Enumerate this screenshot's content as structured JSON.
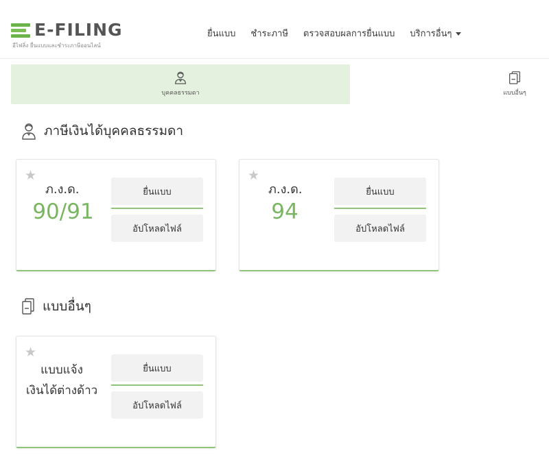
{
  "header": {
    "logo_text": "E-FILING",
    "logo_subtitle": "อีไฟลิ่ง ยื่นแบบและชำระภาษีออนไลน์",
    "nav": [
      {
        "label": "ยื่นแบบ"
      },
      {
        "label": "ชำระภาษี"
      },
      {
        "label": "ตรวจสอบผลการยื่นแบบ"
      },
      {
        "label": "บริการอื่นๆ"
      }
    ]
  },
  "tabs": {
    "personal": "บุคคลธรรมดา",
    "other": "แบบอื่นๆ"
  },
  "sections": {
    "personal_title": "ภาษีเงินได้บุคคลธรรมดา",
    "other_title": "แบบอื่นๆ"
  },
  "cards": [
    {
      "code": "ภ.ง.ด.",
      "number": "90/91",
      "file_label": "ยื่นแบบ",
      "upload_label": "อัปโหลดไฟล์"
    },
    {
      "code": "ภ.ง.ด.",
      "number": "94",
      "file_label": "ยื่นแบบ",
      "upload_label": "อัปโหลดไฟล์"
    },
    {
      "title_line1": "แบบแจ้ง",
      "title_line2": "เงินได้ต่างด้าว",
      "file_label": "ยื่นแบบ",
      "upload_label": "อัปโหลดไฟล์"
    }
  ],
  "colors": {
    "accent": "#7ab661",
    "tab_active_bg": "#e4f1df",
    "logo_green": "#6bb34a"
  },
  "icons": {
    "star": "star-icon",
    "person": "person-icon",
    "document": "document-icon",
    "caret": "caret-down-icon"
  }
}
